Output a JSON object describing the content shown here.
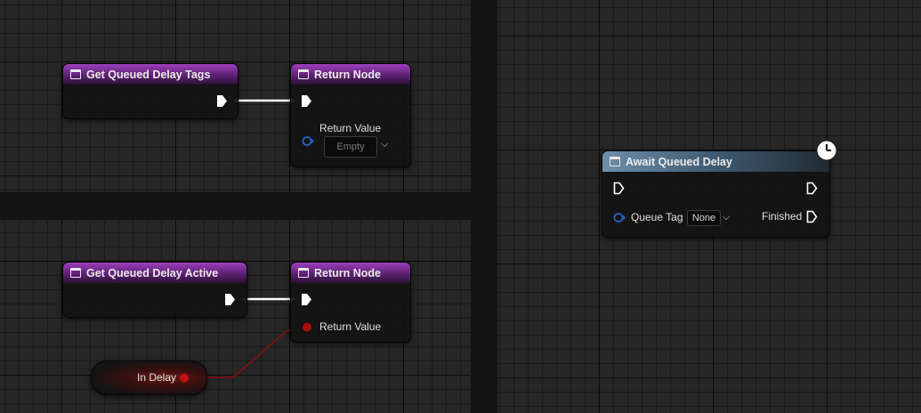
{
  "top_left": {
    "node_tags": {
      "title": "Get Queued Delay Tags"
    },
    "return_node": {
      "title": "Return Node",
      "param_label": "Return Value",
      "param_value": "Empty"
    }
  },
  "bottom_left": {
    "node_active": {
      "title": "Get Queued Delay Active"
    },
    "return_node": {
      "title": "Return Node",
      "param_label": "Return Value"
    },
    "variable": {
      "label": "In Delay"
    }
  },
  "right": {
    "await_node": {
      "title": "Await Queued Delay",
      "param_label": "Queue Tag",
      "param_value": "None",
      "finished_label": "Finished"
    }
  },
  "icons": [
    "function-icon",
    "exec-pin-icon",
    "struct-pin-icon",
    "bool-pin-icon",
    "latent-clock-icon",
    "chevron-down-icon"
  ],
  "colors": {
    "function_header": "#7a2d97",
    "latent_header": "#56748e",
    "bool_pin": "#a60d0d",
    "struct_pin": "#1f63c7",
    "background": "#262626"
  }
}
